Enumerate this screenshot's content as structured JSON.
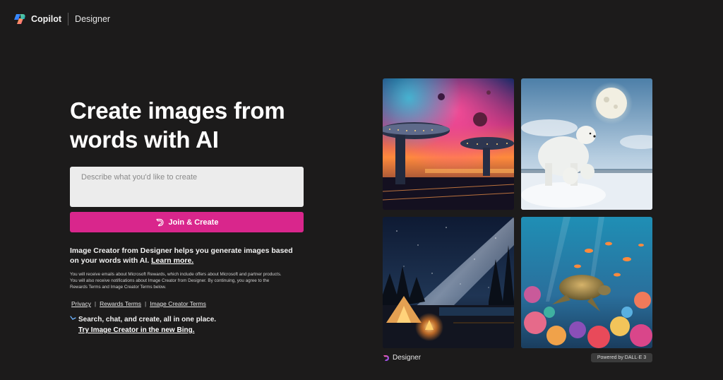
{
  "header": {
    "brand_name": "Copilot",
    "product_name": "Designer"
  },
  "main": {
    "headline": "Create images from words with AI",
    "prompt_placeholder": "Describe what you'd like to create",
    "create_button_label": "Join & Create",
    "info_text": "Image Creator from Designer helps you generate images based on your words with AI.",
    "learn_more_label": "Learn more.",
    "fine_print": "You will receive emails about Microsoft Rewards, which include offers about Microsoft and partner products. You will also receive notifications about Image Creator from Designer. By continuing, you agree to the Rewards Terms and Image Creator Terms below.",
    "links": {
      "privacy": "Privacy",
      "separator": "|",
      "rewards_terms": "Rewards Terms",
      "image_creator_terms": "Image Creator Terms"
    },
    "bing_promo_text": "Search, chat, and create, all in one place.",
    "bing_promo_link": "Try Image Creator in the new Bing."
  },
  "gallery": {
    "images": [
      "sci-fi city under a nebula sky",
      "polar bear with cubs under a full moon",
      "campfire beside a tent under the milky way",
      "sea turtle in a coral reef"
    ]
  },
  "footer": {
    "designer_label": "Designer",
    "powered_by": "Powered by DALL·E 3"
  },
  "colors": {
    "background": "#1c1b1b",
    "accent": "#d9268c",
    "input_bg": "#ececec"
  }
}
